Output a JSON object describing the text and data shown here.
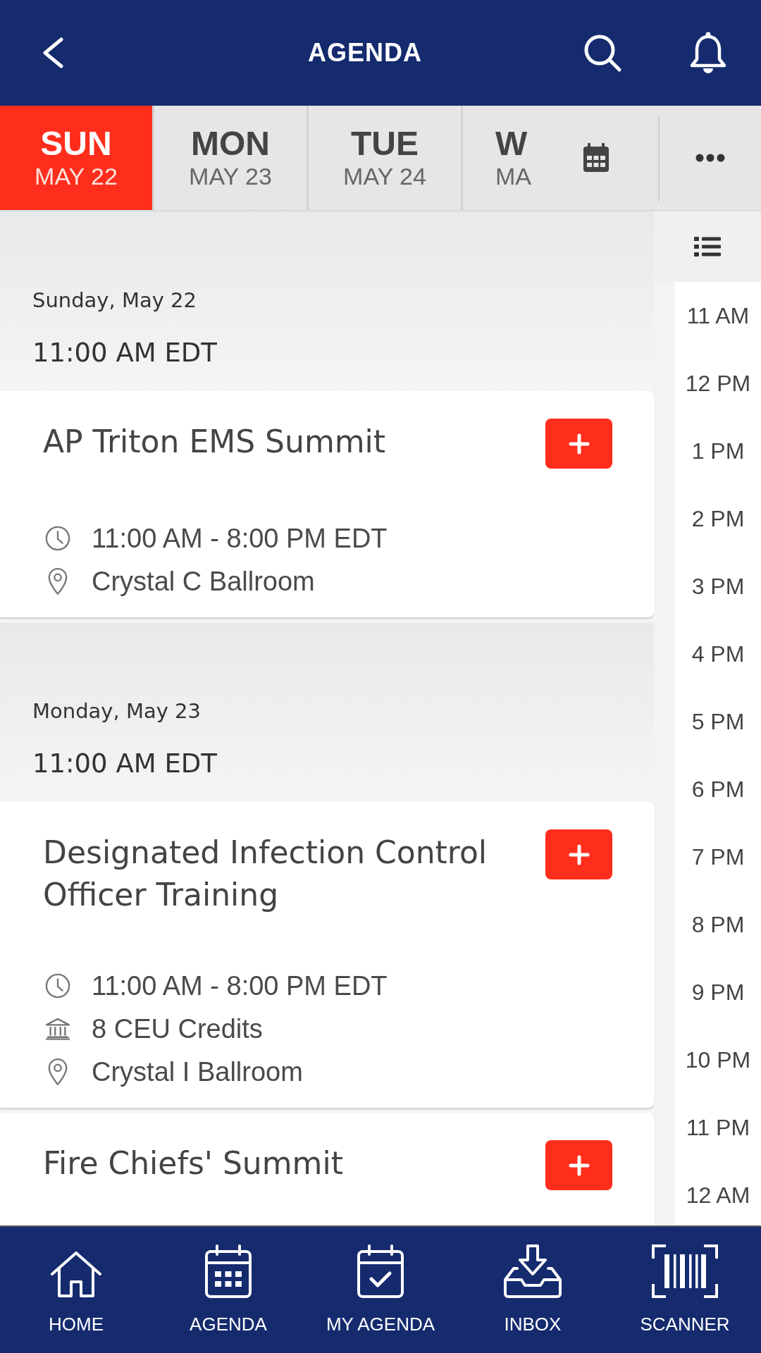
{
  "top_bar": {
    "title": "AGENDA"
  },
  "day_tabs": [
    {
      "day": "SUN",
      "date": "MAY 22",
      "selected": true
    },
    {
      "day": "MON",
      "date": "MAY 23",
      "selected": false
    },
    {
      "day": "TUE",
      "date": "MAY 24",
      "selected": false
    },
    {
      "day": "W",
      "date": "MA",
      "selected": false
    }
  ],
  "sections": [
    {
      "date": "Sunday, May 22",
      "time": "11:00 AM EDT",
      "sessions": [
        {
          "title": "AP Triton EMS Summit",
          "details": [
            {
              "kind": "time",
              "text": "11:00 AM - 8:00 PM EDT"
            },
            {
              "kind": "location",
              "text": "Crystal C Ballroom"
            }
          ]
        }
      ]
    },
    {
      "date": "Monday, May 23",
      "time": "11:00 AM EDT",
      "sessions": [
        {
          "title": "Designated Infection Control Officer Training",
          "details": [
            {
              "kind": "time",
              "text": "11:00 AM - 8:00 PM EDT"
            },
            {
              "kind": "credits",
              "text": "8 CEU Credits"
            },
            {
              "kind": "location",
              "text": "Crystal I Ballroom"
            }
          ]
        },
        {
          "title": "Fire Chiefs' Summit"
        }
      ]
    }
  ],
  "time_rail": {
    "hours": [
      "11 AM",
      "12 PM",
      "1 PM",
      "2 PM",
      "3 PM",
      "4 PM",
      "5 PM",
      "6 PM",
      "7 PM",
      "8 PM",
      "9 PM",
      "10 PM",
      "11 PM",
      "12 AM"
    ]
  },
  "bottom_nav": [
    {
      "kind": "home",
      "label": "HOME"
    },
    {
      "kind": "agenda",
      "label": "AGENDA"
    },
    {
      "kind": "my_agenda",
      "label": "MY AGENDA"
    },
    {
      "kind": "inbox",
      "label": "INBOX"
    },
    {
      "kind": "scanner",
      "label": "SCANNER"
    }
  ]
}
